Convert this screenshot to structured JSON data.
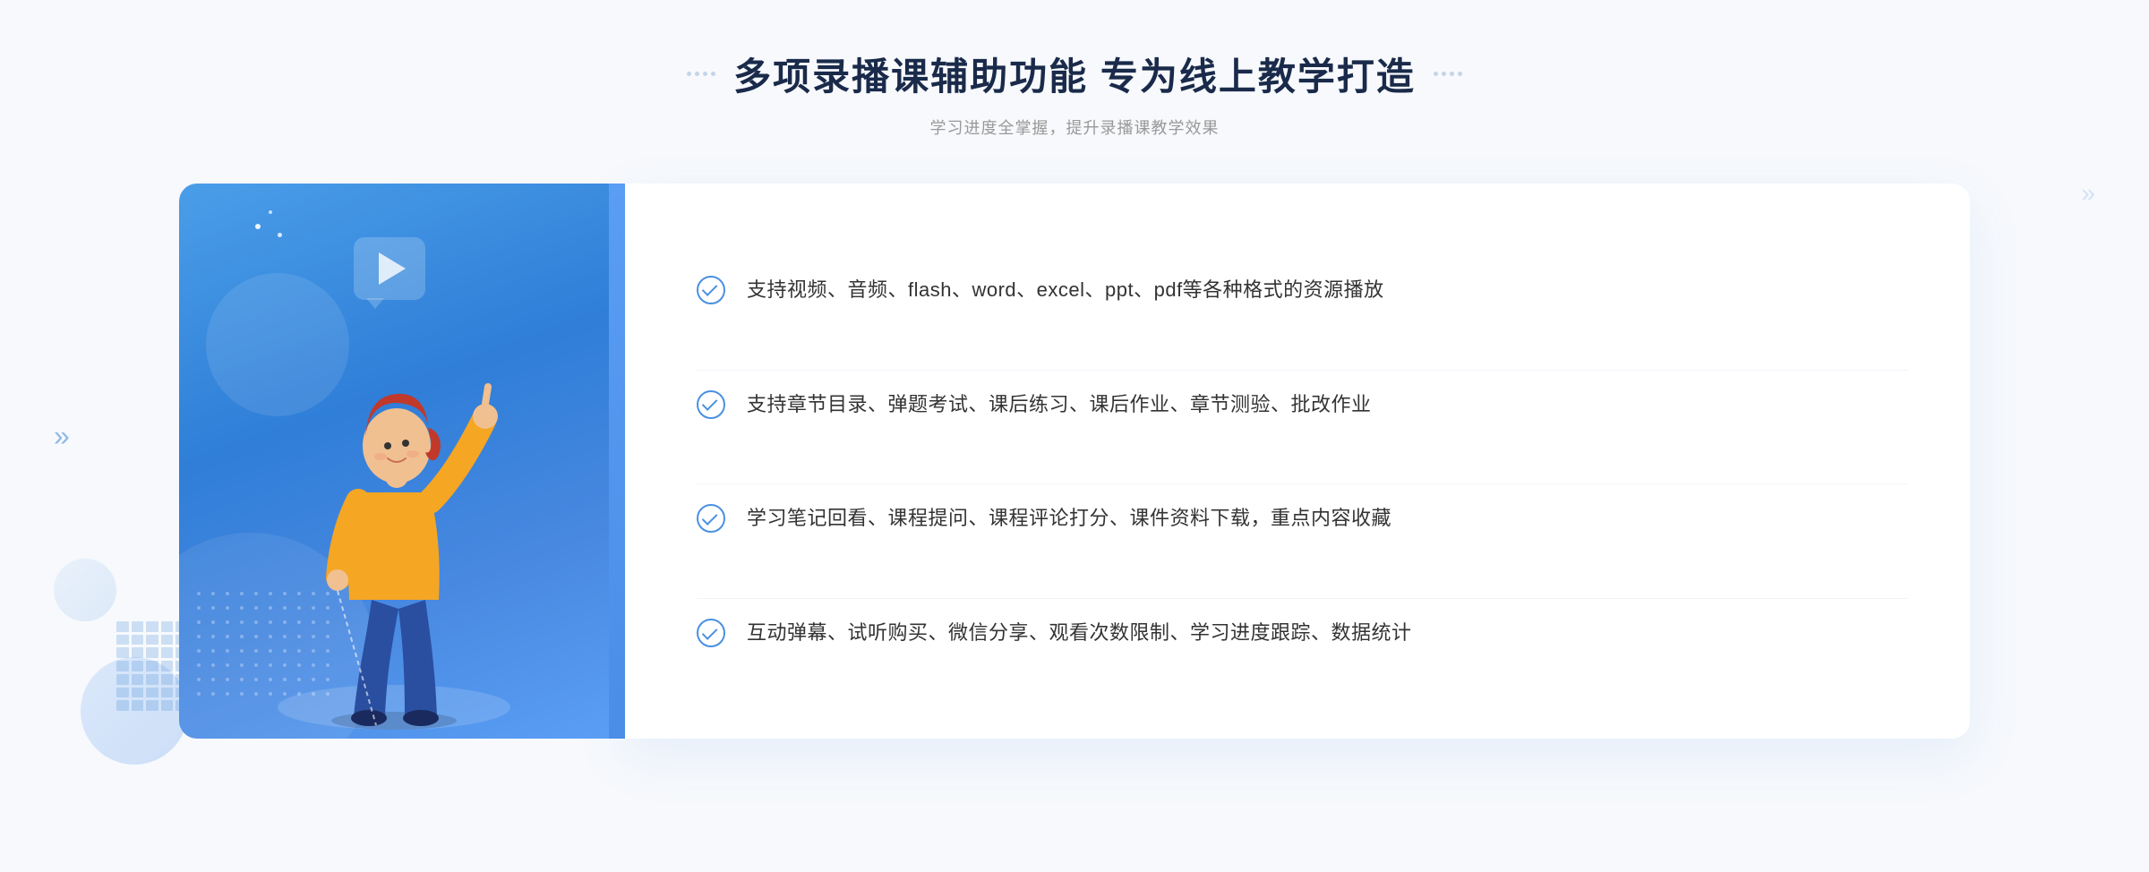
{
  "header": {
    "title": "多项录播课辅助功能 专为线上教学打造",
    "subtitle": "学习进度全掌握，提升录播课教学效果",
    "deco_left": "⁘",
    "deco_right": "⁘"
  },
  "features": [
    {
      "id": "feature-1",
      "text": "支持视频、音频、flash、word、excel、ppt、pdf等各种格式的资源播放"
    },
    {
      "id": "feature-2",
      "text": "支持章节目录、弹题考试、课后练习、课后作业、章节测验、批改作业"
    },
    {
      "id": "feature-3",
      "text": "学习笔记回看、课程提问、课程评论打分、课件资料下载，重点内容收藏"
    },
    {
      "id": "feature-4",
      "text": "互动弹幕、试听购买、微信分享、观看次数限制、学习进度跟踪、数据统计"
    }
  ],
  "chevron_left": "»",
  "chevron_right": "»",
  "colors": {
    "primary": "#4a90e2",
    "card_gradient_start": "#4a9ee8",
    "card_gradient_end": "#5a9ef5",
    "text_dark": "#1a2a4a",
    "text_body": "#333",
    "text_subtitle": "#999"
  }
}
